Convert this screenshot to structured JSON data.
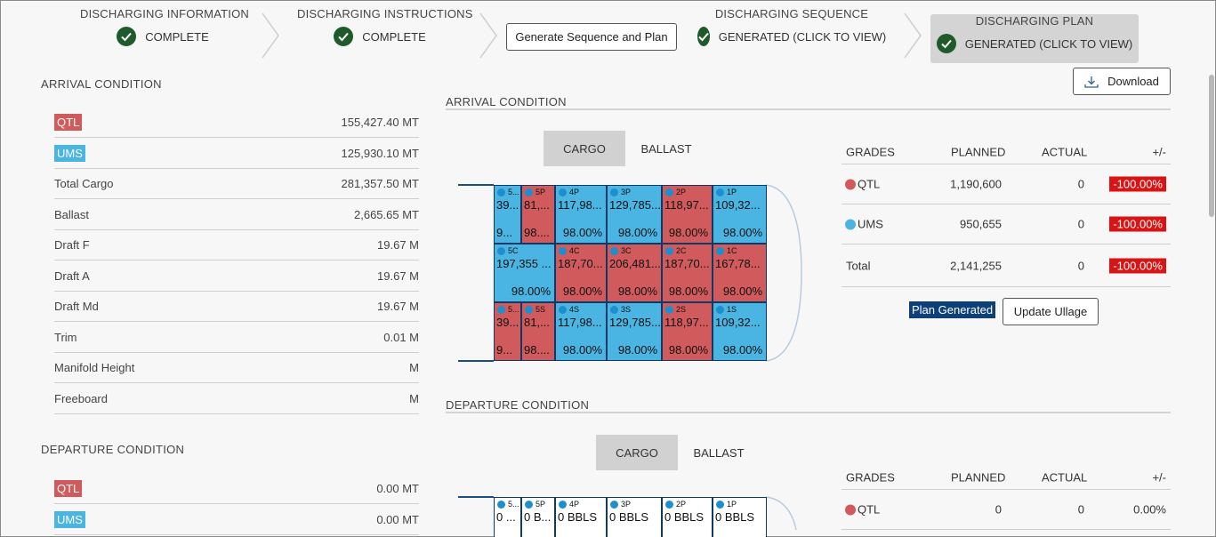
{
  "stepper": {
    "steps": [
      {
        "title": "DISCHARGING INFORMATION",
        "status": "COMPLETE"
      },
      {
        "title": "DISCHARGING INSTRUCTIONS",
        "status": "COMPLETE"
      },
      {
        "title": "DISCHARGING SEQUENCE",
        "status": "GENERATED (CLICK TO VIEW)"
      },
      {
        "title": "DISCHARGING PLAN",
        "status": "GENERATED (CLICK TO VIEW)"
      }
    ],
    "generate_button": "Generate Sequence and Plan"
  },
  "left": {
    "arrival_title": "ARRIVAL CONDITION",
    "arrival_rows": [
      {
        "label": "QTL",
        "value": "155,427.40 MT"
      },
      {
        "label": "UMS",
        "value": "125,930.10 MT"
      },
      {
        "label": "Total Cargo",
        "value": "281,357.50 MT"
      },
      {
        "label": "Ballast",
        "value": "2,665.65 MT"
      },
      {
        "label": "Draft F",
        "value": "19.67 M"
      },
      {
        "label": "Draft A",
        "value": "19.67 M"
      },
      {
        "label": "Draft Md",
        "value": "19.67 M"
      },
      {
        "label": "Trim",
        "value": "0.01 M"
      },
      {
        "label": "Manifold Height",
        "value": "M"
      },
      {
        "label": "Freeboard",
        "value": "M"
      }
    ],
    "departure_title": "DEPARTURE CONDITION",
    "departure_rows": [
      {
        "label": "QTL",
        "value": "0.00 MT"
      },
      {
        "label": "UMS",
        "value": "0.00 MT"
      }
    ]
  },
  "right": {
    "download_label": "Download",
    "arrival_title": "ARRIVAL CONDITION",
    "departure_title": "DEPARTURE CONDITION",
    "toggle": {
      "cargo": "CARGO",
      "ballast": "BALLAST"
    },
    "arrival_tanks": [
      {
        "id": "5...",
        "vol": "39...",
        "pct": "9...",
        "color": "b"
      },
      {
        "id": "5P",
        "vol": "81,...",
        "pct": "98....",
        "color": "r"
      },
      {
        "id": "4P",
        "vol": "117,98...",
        "pct": "98.00%",
        "color": "b"
      },
      {
        "id": "3P",
        "vol": "129,785...",
        "pct": "98.00%",
        "color": "b"
      },
      {
        "id": "2P",
        "vol": "118,97...",
        "pct": "98.00%",
        "color": "r"
      },
      {
        "id": "1P",
        "vol": "109,32...",
        "pct": "98.00%",
        "color": "b"
      },
      {
        "id": "5C",
        "vol": "197,355 ...",
        "pct": "98.00%",
        "color": "b"
      },
      {
        "id": "4C",
        "vol": "187,70...",
        "pct": "98.00%",
        "color": "r"
      },
      {
        "id": "3C",
        "vol": "206,481...",
        "pct": "98.00%",
        "color": "r"
      },
      {
        "id": "2C",
        "vol": "187,70...",
        "pct": "98.00%",
        "color": "r"
      },
      {
        "id": "1C",
        "vol": "167,78...",
        "pct": "98.00%",
        "color": "r"
      },
      {
        "id": "5...",
        "vol": "39...",
        "pct": "9...",
        "color": "r"
      },
      {
        "id": "5S",
        "vol": "81,...",
        "pct": "98....",
        "color": "r"
      },
      {
        "id": "4S",
        "vol": "117,98...",
        "pct": "98.00%",
        "color": "b"
      },
      {
        "id": "3S",
        "vol": "129,785...",
        "pct": "98.00%",
        "color": "b"
      },
      {
        "id": "2S",
        "vol": "118,97...",
        "pct": "98.00%",
        "color": "r"
      },
      {
        "id": "1S",
        "vol": "109,32...",
        "pct": "98.00%",
        "color": "b"
      }
    ],
    "departure_tanks": [
      {
        "id": "5...",
        "vol": "0 ..."
      },
      {
        "id": "5P",
        "vol": "0 B..."
      },
      {
        "id": "4P",
        "vol": "0 BBLS"
      },
      {
        "id": "3P",
        "vol": "0 BBLS"
      },
      {
        "id": "2P",
        "vol": "0 BBLS"
      },
      {
        "id": "1P",
        "vol": "0 BBLS"
      }
    ],
    "grades_table": {
      "headers": [
        "GRADES",
        "PLANNED",
        "ACTUAL",
        "+/-"
      ],
      "rows": [
        {
          "grade": "QTL",
          "planned": "1,190,600",
          "actual": "0",
          "diff": "-100.00%",
          "color": "#d05a5c"
        },
        {
          "grade": "UMS",
          "planned": "950,655",
          "actual": "0",
          "diff": "-100.00%",
          "color": "#4ab4e2"
        },
        {
          "grade": "Total",
          "planned": "2,141,255",
          "actual": "0",
          "diff": "-100.00%"
        }
      ]
    },
    "plan_generated": "Plan Generated",
    "update_ullage": "Update Ullage",
    "departure_table": {
      "headers": [
        "GRADES",
        "PLANNED",
        "ACTUAL",
        "+/-"
      ],
      "rows": [
        {
          "grade": "QTL",
          "planned": "0",
          "actual": "0",
          "diff": "0.00%",
          "color": "#d05a5c"
        }
      ]
    }
  }
}
